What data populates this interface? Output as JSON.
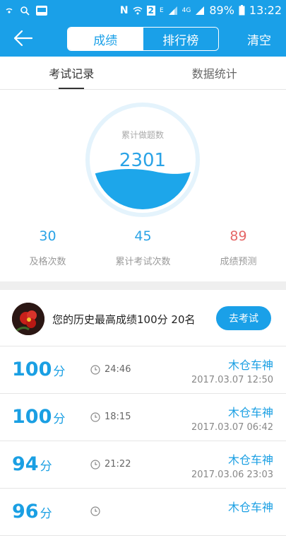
{
  "status_bar": {
    "battery": "89%",
    "time": "13:22",
    "network": "4G",
    "sim_badge": "2",
    "signal_e": "E"
  },
  "app_bar": {
    "segments": [
      "成绩",
      "排行榜"
    ],
    "clear_label": "清空"
  },
  "tabs": [
    "考试记录",
    "数据统计"
  ],
  "stats": {
    "circle_label": "累计做题数",
    "circle_value": "2301",
    "items": [
      {
        "value": "30",
        "label": "及格次数"
      },
      {
        "value": "45",
        "label": "累计考试次数"
      },
      {
        "value": "89",
        "label": "成绩预测"
      }
    ]
  },
  "best": {
    "text": "您的历史最高成绩100分  20名",
    "button": "去考试"
  },
  "records": [
    {
      "score": "100",
      "unit": "分",
      "duration": "24:46",
      "name": "木仓车神",
      "date": "2017.03.07  12:50"
    },
    {
      "score": "100",
      "unit": "分",
      "duration": "18:15",
      "name": "木仓车神",
      "date": "2017.03.07  06:42"
    },
    {
      "score": "94",
      "unit": "分",
      "duration": "21:22",
      "name": "木仓车神",
      "date": "2017.03.06  23:03"
    },
    {
      "score": "96",
      "unit": "分",
      "duration": "",
      "name": "木仓车神",
      "date": ""
    }
  ],
  "colors": {
    "accent": "#1aa0e8",
    "prediction": "#e56767"
  }
}
